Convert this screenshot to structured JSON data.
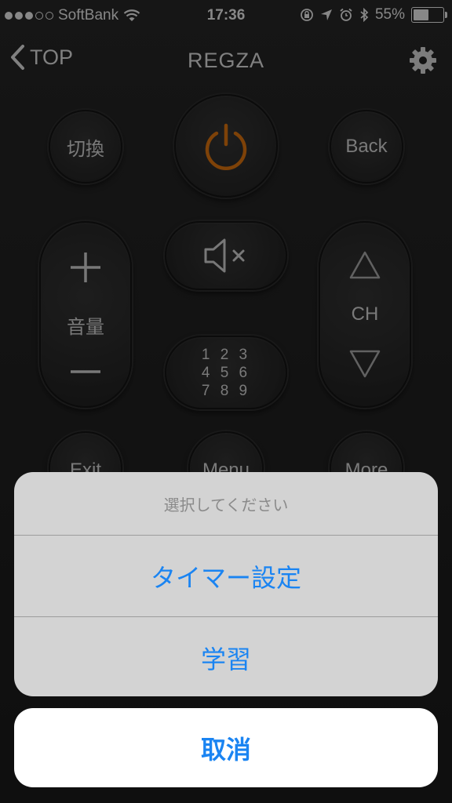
{
  "status_bar": {
    "carrier": "SoftBank",
    "time": "17:36",
    "battery_percent": "55%",
    "battery_level": 0.55,
    "signal_dots_filled": 3,
    "signal_dots_total": 5
  },
  "nav": {
    "back_label": "TOP",
    "title": "REGZA"
  },
  "remote": {
    "switch_label": "切換",
    "back_label": "Back",
    "volume_label": "音量",
    "channel_label": "CH",
    "numpad_label": "1 2 3\n4 5 6\n7 8 9",
    "exit_label": "Exit",
    "menu_label": "Menu",
    "more_label": "More",
    "power_color": "#d9720f"
  },
  "action_sheet": {
    "title": "選択してください",
    "items": [
      {
        "label": "タイマー設定"
      },
      {
        "label": "学習"
      }
    ],
    "cancel_label": "取消",
    "accent_color": "#1a84f2"
  }
}
